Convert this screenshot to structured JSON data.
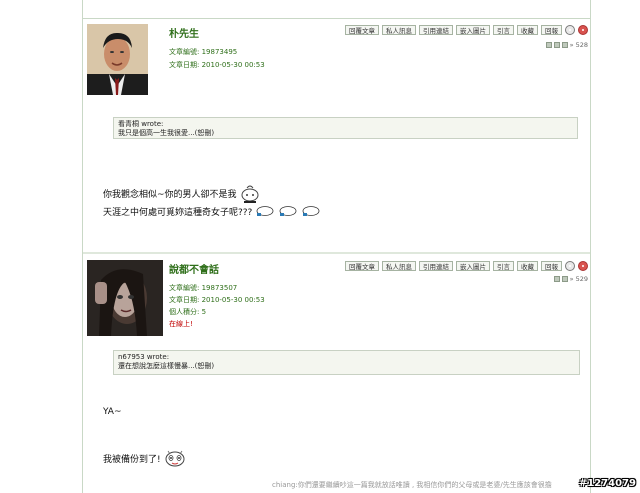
{
  "post_buttons": [
    "回覆文章",
    "私人訊息",
    "引用連結",
    "嵌入圖片",
    "引言",
    "收藏",
    "回報"
  ],
  "posts": [
    {
      "username": "朴先生",
      "article_count_label": "文章編號:",
      "article_count": "19873495",
      "date_label": "文章日期:",
      "date": "2010-05-30 00:53",
      "post_number": "528",
      "quote_author": "看青桐 wrote:",
      "quote_text": "我只是個高一生我很愛...(恕刪)",
      "lines": [
        "你我觀念相似~你的男人卻不是我",
        "天涯之中何處可覓妳這種奇女子呢???"
      ]
    },
    {
      "username": "說都不會話",
      "article_count_label": "文章編號:",
      "article_count": "19873507",
      "date_label": "文章日期:",
      "date": "2010-05-30 00:53",
      "points_label": "個人積分:",
      "points": "5",
      "status": "在線上!",
      "post_number": "529",
      "quote_author": "n67953 wrote:",
      "quote_text": "還在想說怎麼這樣慢暴...(恕刪)",
      "lines": [
        "YA~",
        "我被備份到了!"
      ]
    }
  ],
  "footer_note": "chiang:你們還要繼續吵這一篇我就放話唯讀 , 我相信你們的父母或是老婆/先生應該會很擔",
  "watermark": "#1274079"
}
